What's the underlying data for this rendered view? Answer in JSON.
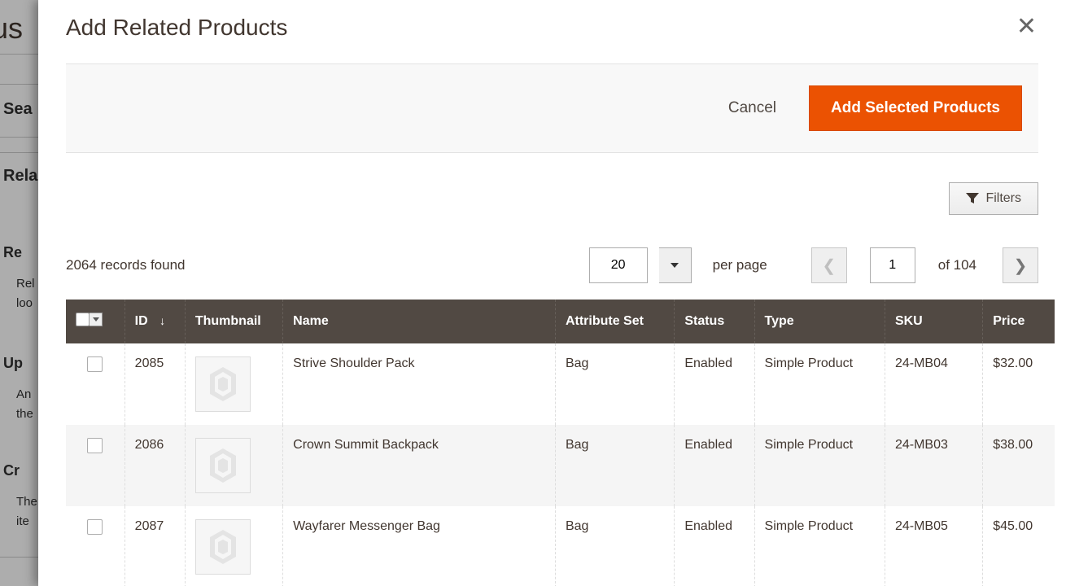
{
  "bg": {
    "title_fragment": "ous",
    "sections": {
      "seo": "Sea",
      "related": "Rela",
      "r1_title": "Re",
      "r1_line1": "Rel",
      "r1_line2": "loo",
      "r2_title": "Up",
      "r2_line1": "An",
      "r2_line2": "the",
      "r3_title": "Cr",
      "r3_line1": "The",
      "r3_line2": "ite"
    }
  },
  "modal": {
    "title": "Add Related Products",
    "cancel": "Cancel",
    "primary": "Add Selected Products",
    "filters": "Filters",
    "records_found": "2064 records found",
    "per_page_value": "20",
    "per_page_label": "per page",
    "page_value": "1",
    "of_total": "of 104"
  },
  "columns": {
    "id": "ID",
    "thumb": "Thumbnail",
    "name": "Name",
    "attrset": "Attribute Set",
    "status": "Status",
    "type": "Type",
    "sku": "SKU",
    "price": "Price"
  },
  "rows": [
    {
      "id": "2085",
      "name": "Strive Shoulder Pack",
      "attrset": "Bag",
      "status": "Enabled",
      "type": "Simple Product",
      "sku": "24-MB04",
      "price": "$32.00"
    },
    {
      "id": "2086",
      "name": "Crown Summit Backpack",
      "attrset": "Bag",
      "status": "Enabled",
      "type": "Simple Product",
      "sku": "24-MB03",
      "price": "$38.00"
    },
    {
      "id": "2087",
      "name": "Wayfarer Messenger Bag",
      "attrset": "Bag",
      "status": "Enabled",
      "type": "Simple Product",
      "sku": "24-MB05",
      "price": "$45.00"
    }
  ]
}
